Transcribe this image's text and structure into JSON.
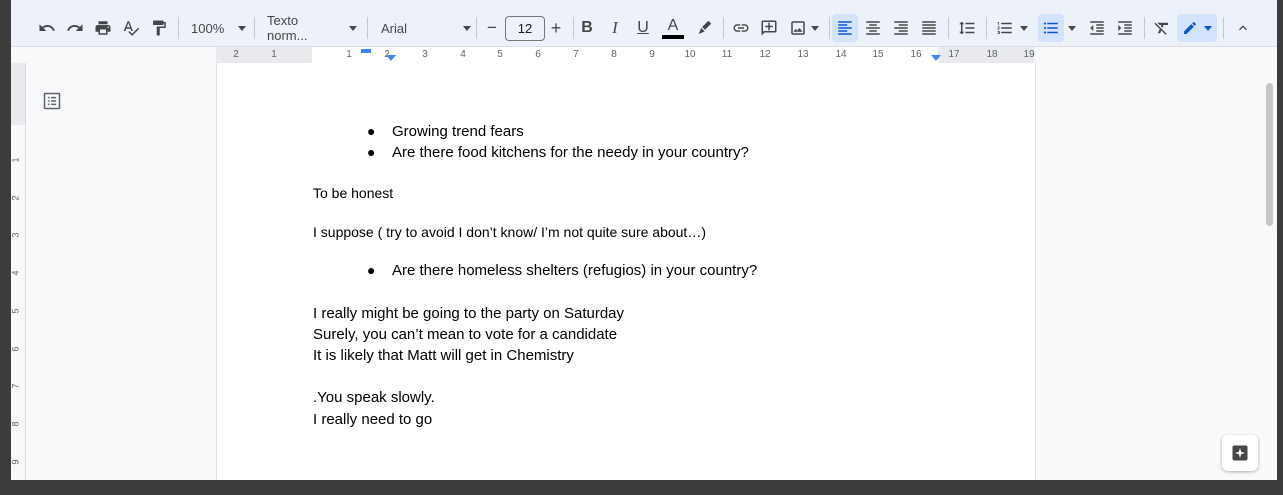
{
  "toolbar": {
    "zoom": "100%",
    "style": "Texto norm...",
    "font": "Arial",
    "font_size": "12",
    "minus": "−",
    "plus": "+",
    "bold": "B",
    "italic": "I",
    "underline": "U",
    "text_color": "A",
    "text_color_swatch": "#000000"
  },
  "ruler": {
    "left_numbers": [
      "2",
      "1"
    ],
    "numbers": [
      "1",
      "2",
      "3",
      "4",
      "5",
      "6",
      "7",
      "8",
      "9",
      "10",
      "11",
      "12",
      "13",
      "14",
      "15",
      "16",
      "17",
      "18",
      "19"
    ],
    "vertical_numbers": [
      "1",
      "2",
      "3",
      "4",
      "5",
      "6",
      "7",
      "8",
      "9"
    ]
  },
  "document": {
    "bullets_1": [
      "Growing trend fears",
      "Are there food kitchens for the needy in your country?"
    ],
    "para_1": "To be honest",
    "para_2": "I suppose ( try to avoid I don’t know/ I’m not quite sure about…)",
    "bullets_2": [
      "Are there homeless shelters (refugios) in your country?"
    ],
    "lines": [
      "I really might be going to the party on Saturday",
      "Surely, you can’t mean to vote for a candidate",
      "It is likely that Matt will get in Chemistry",
      ".You speak slowly.",
      "I really need to go"
    ]
  },
  "colors": {
    "accent": "#0b57d0",
    "active_bg": "#d3e3fd"
  }
}
